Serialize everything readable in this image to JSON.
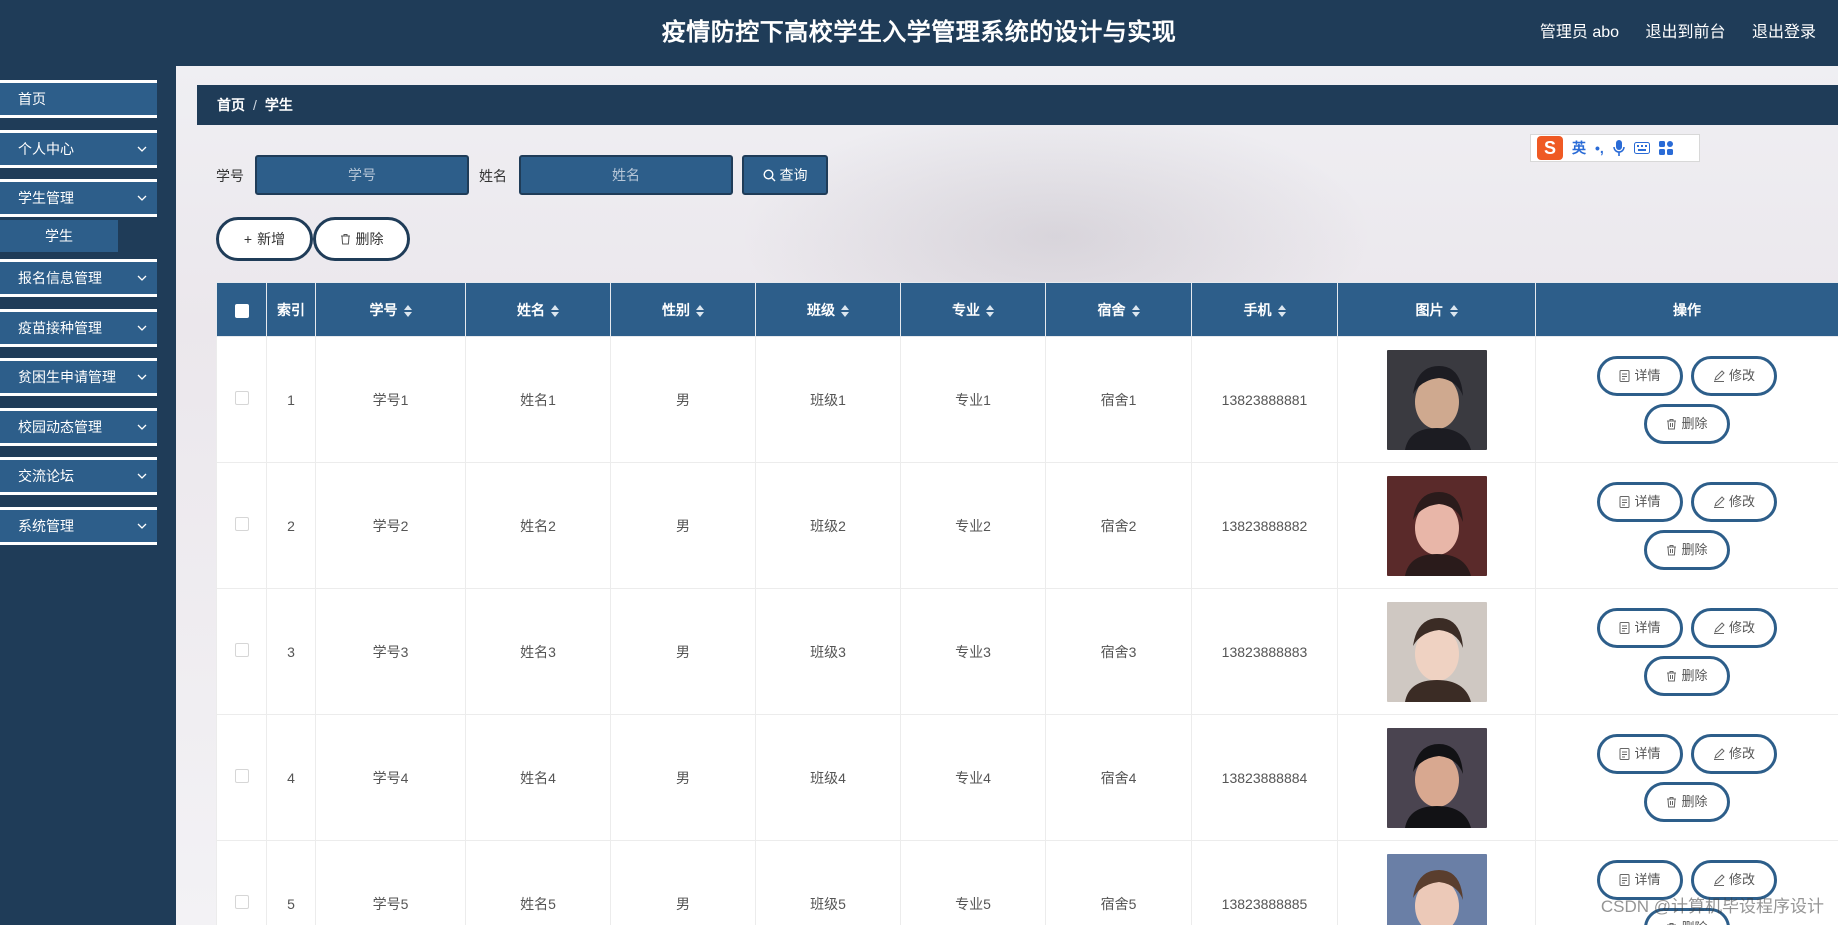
{
  "header": {
    "title": "疫情防控下高校学生入学管理系统的设计与实现",
    "user": "管理员 abo",
    "front_link": "退出到前台",
    "logout_link": "退出登录"
  },
  "sidebar": {
    "items": [
      {
        "label": "首页"
      },
      {
        "label": "个人中心"
      },
      {
        "label": "学生管理"
      },
      {
        "label": "报名信息管理"
      },
      {
        "label": "疫苗接种管理"
      },
      {
        "label": "贫困生申请管理"
      },
      {
        "label": "校园动态管理"
      },
      {
        "label": "交流论坛"
      },
      {
        "label": "系统管理"
      }
    ],
    "sub_item": "学生"
  },
  "breadcrumb": {
    "home": "首页",
    "sep": "/",
    "current": "学生"
  },
  "ime": {
    "lang": "英",
    "punct": "•,"
  },
  "search": {
    "id_label": "学号",
    "id_placeholder": "学号",
    "name_label": "姓名",
    "name_placeholder": "姓名",
    "query_label": "查询"
  },
  "toolbar": {
    "add_label": "新增",
    "delete_label": "删除"
  },
  "table": {
    "headers": [
      "索引",
      "学号",
      "姓名",
      "性别",
      "班级",
      "专业",
      "宿舍",
      "手机",
      "图片",
      "操作"
    ],
    "rows": [
      {
        "index": "1",
        "id": "学号1",
        "name": "姓名1",
        "gender": "男",
        "class": "班级1",
        "major": "专业1",
        "dorm": "宿舍1",
        "phone": "13823888881"
      },
      {
        "index": "2",
        "id": "学号2",
        "name": "姓名2",
        "gender": "男",
        "class": "班级2",
        "major": "专业2",
        "dorm": "宿舍2",
        "phone": "13823888882"
      },
      {
        "index": "3",
        "id": "学号3",
        "name": "姓名3",
        "gender": "男",
        "class": "班级3",
        "major": "专业3",
        "dorm": "宿舍3",
        "phone": "13823888883"
      },
      {
        "index": "4",
        "id": "学号4",
        "name": "姓名4",
        "gender": "男",
        "class": "班级4",
        "major": "专业4",
        "dorm": "宿舍4",
        "phone": "13823888884"
      },
      {
        "index": "5",
        "id": "学号5",
        "name": "姓名5",
        "gender": "男",
        "class": "班级5",
        "major": "专业5",
        "dorm": "宿舍5",
        "phone": "13823888885"
      }
    ],
    "actions": {
      "detail": "详情",
      "edit": "修改",
      "delete": "删除"
    }
  },
  "watermark": "CSDN @计算机毕设程序设计",
  "colors": {
    "navy": "#1f3c58",
    "blue": "#2d5e8a",
    "ime_orange": "#ef5a24"
  }
}
